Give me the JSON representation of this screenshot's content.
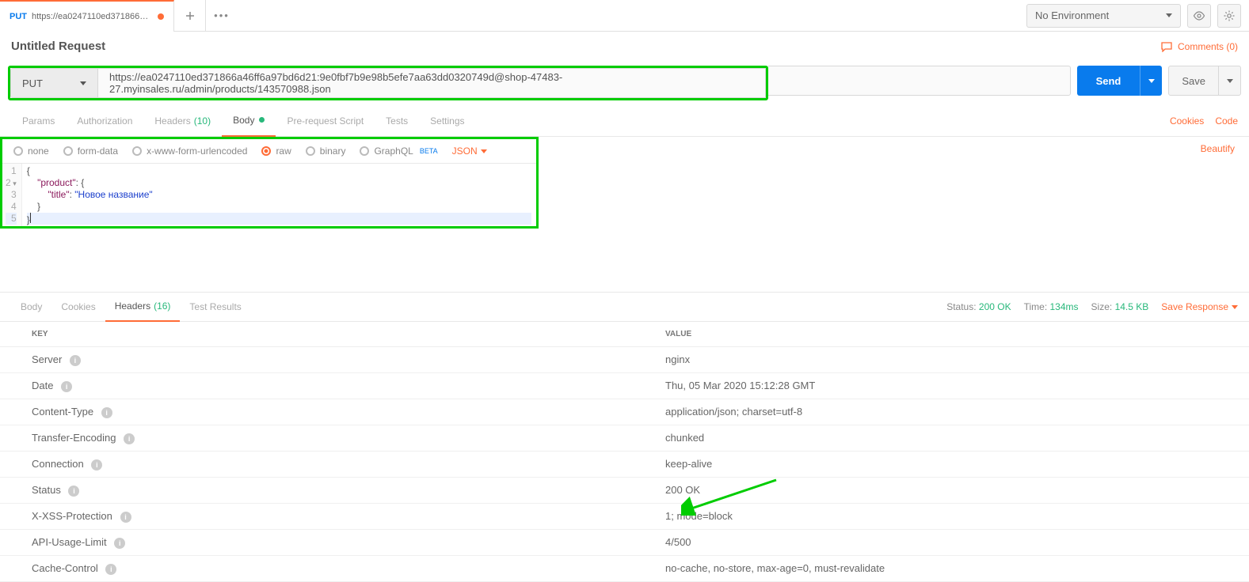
{
  "tab": {
    "method": "PUT",
    "title": "https://ea0247110ed371866a4..."
  },
  "env": {
    "selected": "No Environment"
  },
  "request": {
    "name": "Untitled Request",
    "comments_label": "Comments (0)",
    "method": "PUT",
    "url": "https://ea0247110ed371866a46ff6a97bd6d21:9e0fbf7b9e98b5efe7aa63dd0320749d@shop-47483-27.myinsales.ru/admin/products/143570988.json",
    "send_label": "Send",
    "save_label": "Save"
  },
  "req_tabs": {
    "params": "Params",
    "auth": "Authorization",
    "headers": "Headers",
    "headers_count": "(10)",
    "body": "Body",
    "prereq": "Pre-request Script",
    "tests": "Tests",
    "settings": "Settings",
    "cookies": "Cookies",
    "code": "Code"
  },
  "body_types": {
    "none": "none",
    "formdata": "form-data",
    "urlenc": "x-www-form-urlencoded",
    "raw": "raw",
    "binary": "binary",
    "graphql": "GraphQL",
    "beta": "BETA",
    "json": "JSON",
    "beautify": "Beautify"
  },
  "editor": {
    "l1": "{",
    "l2_key": "\"product\"",
    "l2_after": ": {",
    "l3_key": "\"title\"",
    "l3_mid": ": ",
    "l3_val": "\"Новое название\"",
    "l4": "    }",
    "l5": "}",
    "gutter": [
      "1",
      "2",
      "3",
      "4",
      "5"
    ]
  },
  "resp_tabs": {
    "body": "Body",
    "cookies": "Cookies",
    "headers": "Headers",
    "headers_count": "(16)",
    "test_results": "Test Results"
  },
  "resp_meta": {
    "status_lbl": "Status:",
    "status_val": "200 OK",
    "time_lbl": "Time:",
    "time_val": "134ms",
    "size_lbl": "Size:",
    "size_val": "14.5 KB",
    "save_resp": "Save Response"
  },
  "headers_table": {
    "key_header": "Key",
    "value_header": "Value",
    "rows": [
      {
        "k": "Server",
        "v": "nginx"
      },
      {
        "k": "Date",
        "v": "Thu, 05 Mar 2020 15:12:28 GMT"
      },
      {
        "k": "Content-Type",
        "v": "application/json; charset=utf-8"
      },
      {
        "k": "Transfer-Encoding",
        "v": "chunked"
      },
      {
        "k": "Connection",
        "v": "keep-alive"
      },
      {
        "k": "Status",
        "v": "200 OK"
      },
      {
        "k": "X-XSS-Protection",
        "v": "1; mode=block"
      },
      {
        "k": "API-Usage-Limit",
        "v": "4/500"
      },
      {
        "k": "Cache-Control",
        "v": "no-cache, no-store, max-age=0, must-revalidate"
      }
    ]
  }
}
